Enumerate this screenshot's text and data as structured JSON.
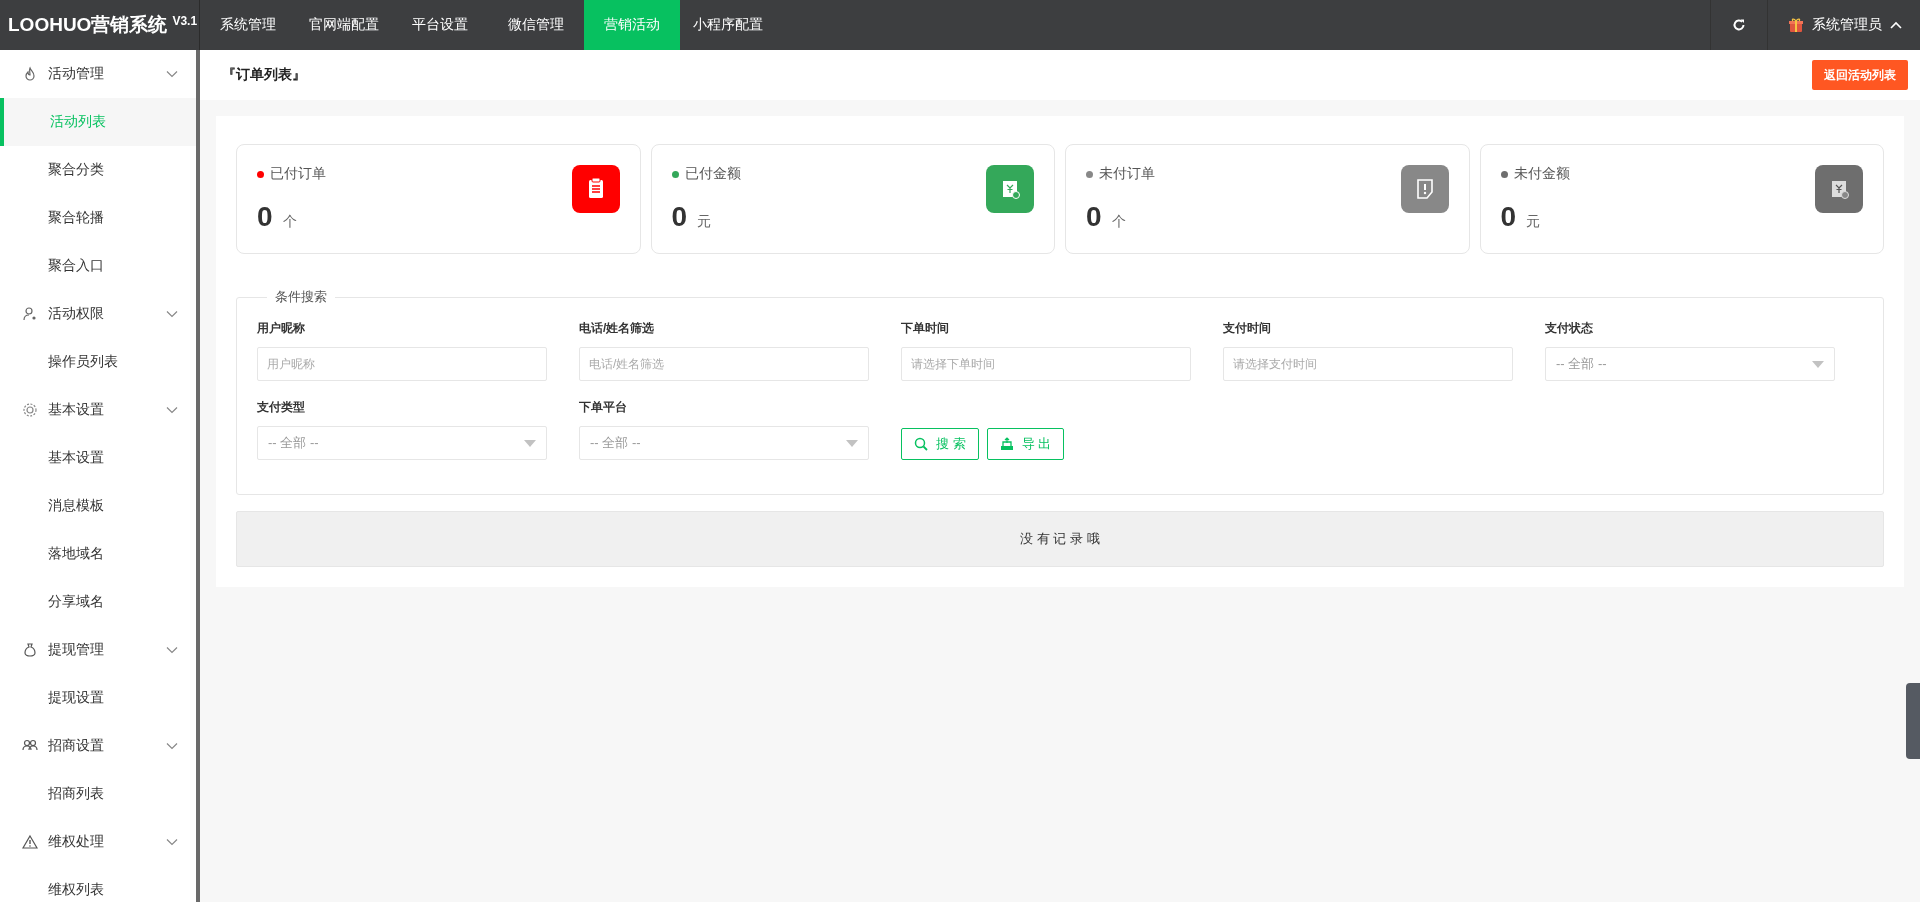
{
  "app": {
    "logo": "LOOHUO营销系统",
    "version": "V3.1"
  },
  "top_nav": [
    {
      "label": "系统管理",
      "selected": false
    },
    {
      "label": "官网端配置",
      "selected": false
    },
    {
      "label": "平台设置",
      "selected": false
    },
    {
      "label": "微信管理",
      "selected": false
    },
    {
      "label": "营销活动",
      "selected": true
    },
    {
      "label": "小程序配置",
      "selected": false
    }
  ],
  "user": {
    "name": "系统管理员"
  },
  "sidebar": [
    {
      "label": "活动管理",
      "expanded": true,
      "children": [
        {
          "label": "活动列表",
          "selected": true
        },
        {
          "label": "聚合分类",
          "selected": false
        },
        {
          "label": "聚合轮播",
          "selected": false
        },
        {
          "label": "聚合入口",
          "selected": false
        }
      ]
    },
    {
      "label": "活动权限",
      "expanded": true,
      "children": [
        {
          "label": "操作员列表",
          "selected": false
        }
      ]
    },
    {
      "label": "基本设置",
      "expanded": true,
      "children": [
        {
          "label": "基本设置",
          "selected": false
        },
        {
          "label": "消息模板",
          "selected": false
        },
        {
          "label": "落地域名",
          "selected": false
        },
        {
          "label": "分享域名",
          "selected": false
        }
      ]
    },
    {
      "label": "提现管理",
      "expanded": true,
      "children": [
        {
          "label": "提现设置",
          "selected": false
        }
      ]
    },
    {
      "label": "招商设置",
      "expanded": true,
      "children": [
        {
          "label": "招商列表",
          "selected": false
        }
      ]
    },
    {
      "label": "维权处理",
      "expanded": true,
      "children": [
        {
          "label": "维权列表",
          "selected": false
        }
      ]
    }
  ],
  "page": {
    "title": "『订单列表』",
    "back_button": "返回活动列表"
  },
  "stats": [
    {
      "label": "已付订单",
      "value": "0",
      "unit": "个",
      "color": "#ff0000"
    },
    {
      "label": "已付金额",
      "value": "0",
      "unit": "元",
      "color": "#34a85a"
    },
    {
      "label": "未付订单",
      "value": "0",
      "unit": "个",
      "color": "#888888"
    },
    {
      "label": "未付金额",
      "value": "0",
      "unit": "元",
      "color": "#6e6e6e"
    }
  ],
  "search": {
    "legend": "条件搜索",
    "fields": [
      {
        "label": "用户昵称",
        "kind": "text",
        "placeholder": "用户昵称"
      },
      {
        "label": "电话/姓名筛选",
        "kind": "text",
        "placeholder": "电话/姓名筛选"
      },
      {
        "label": "下单时间",
        "kind": "text",
        "placeholder": "请选择下单时间"
      },
      {
        "label": "支付时间",
        "kind": "text",
        "placeholder": "请选择支付时间"
      },
      {
        "label": "支付状态",
        "kind": "select",
        "value": "-- 全部 --"
      },
      {
        "label": "支付类型",
        "kind": "select",
        "value": "-- 全部 --"
      },
      {
        "label": "下单平台",
        "kind": "select",
        "value": "-- 全部 --"
      }
    ],
    "buttons": [
      {
        "label": "搜 索",
        "kind": "search"
      },
      {
        "label": "导 出",
        "kind": "export"
      }
    ]
  },
  "empty_message": "没 有 记 录 哦"
}
